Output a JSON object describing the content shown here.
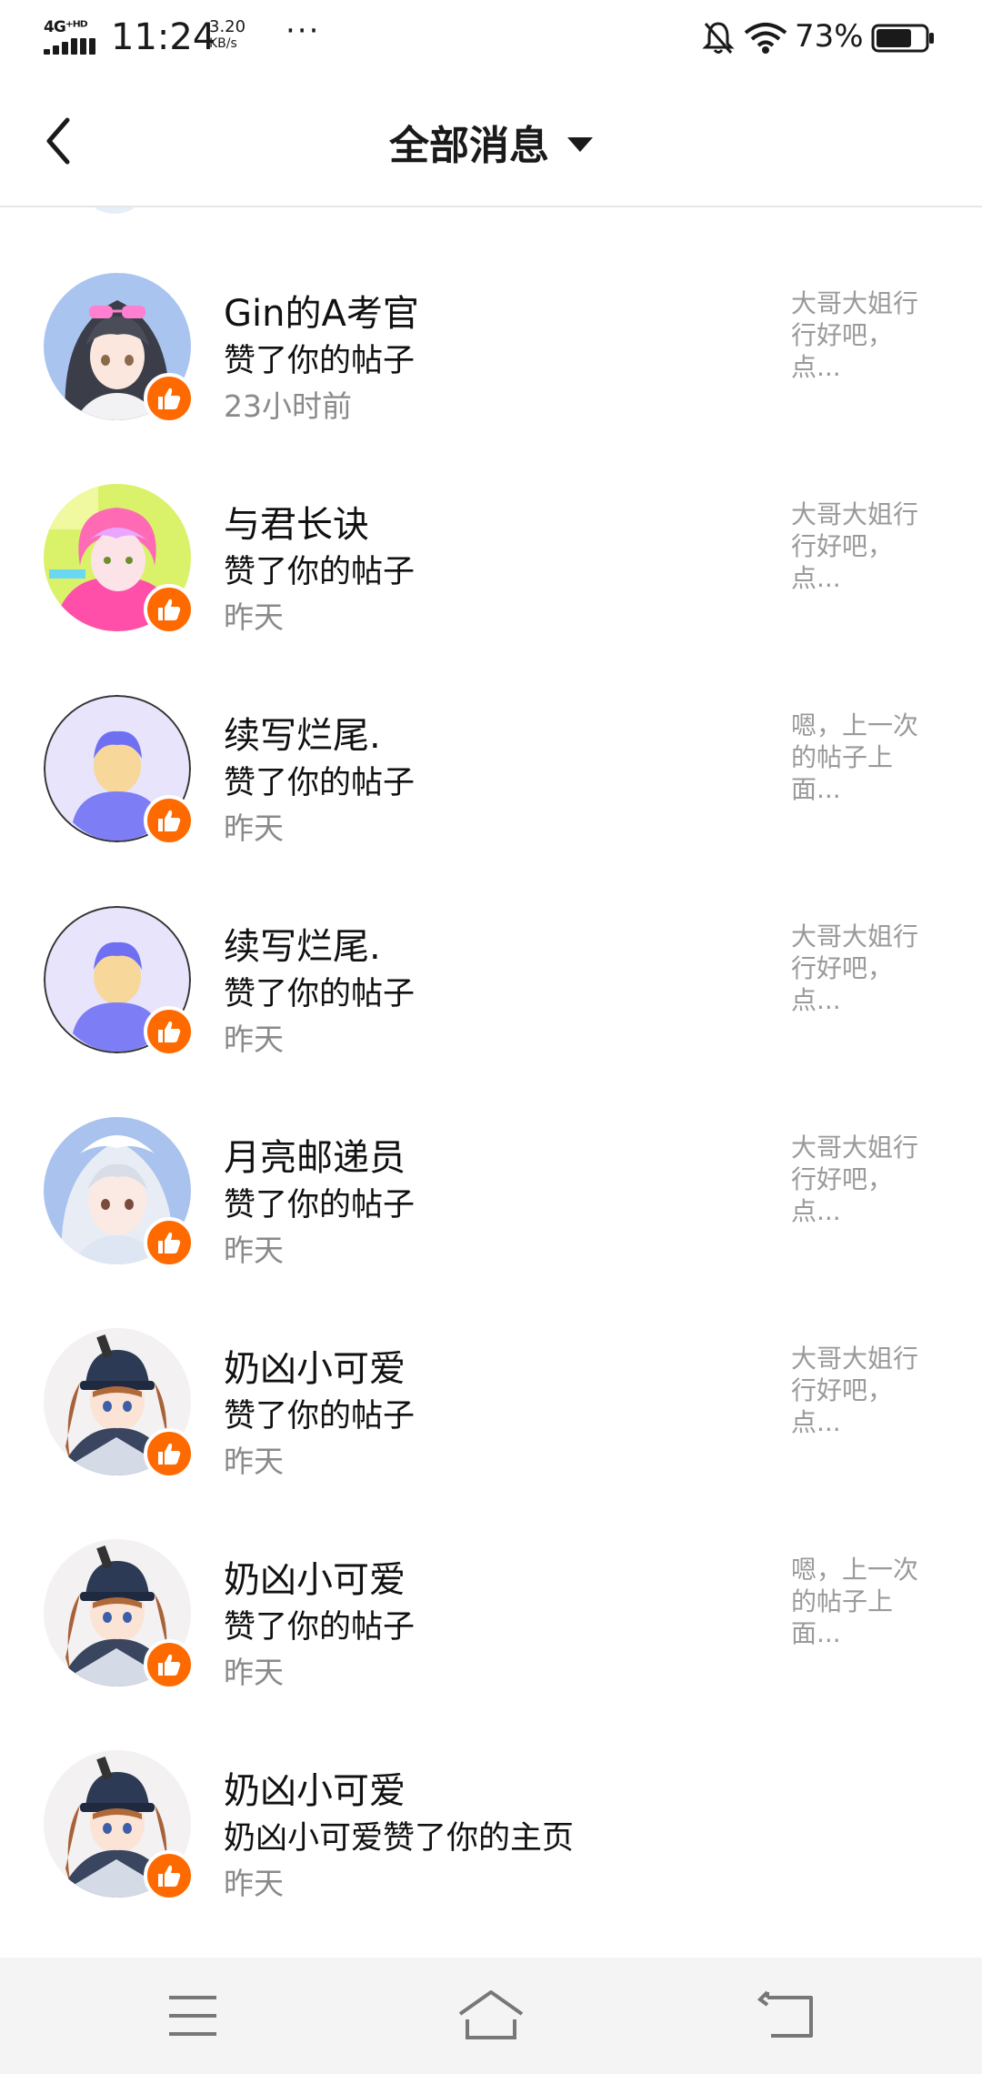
{
  "status_bar": {
    "network": "4G⁺ᴴᴰ",
    "time": "11:24",
    "speed_value": "3.20",
    "speed_unit": "KB/s",
    "more": "···",
    "battery_percent": "73%",
    "battery_level": 0.73
  },
  "header": {
    "title": "全部消息"
  },
  "colors": {
    "accent": "#ff6a00",
    "text_primary": "#111111",
    "text_secondary": "#8a8a8a"
  },
  "messages": [
    {
      "name": "Gin的A考官",
      "action": "赞了你的帖子",
      "time": "23小时前",
      "preview": "大哥大姐行行好吧，点...",
      "avatar": "anime-girl-glasses"
    },
    {
      "name": "与君长诀",
      "action": "赞了你的帖子",
      "time": "昨天",
      "preview": "大哥大姐行行好吧，点...",
      "avatar": "anime-pink-hair"
    },
    {
      "name": "续写烂尾.",
      "action": "赞了你的帖子",
      "time": "昨天",
      "preview": "嗯，上一次的帖子上面...",
      "avatar": "default-avatar"
    },
    {
      "name": "续写烂尾.",
      "action": "赞了你的帖子",
      "time": "昨天",
      "preview": "大哥大姐行行好吧，点...",
      "avatar": "default-avatar"
    },
    {
      "name": "月亮邮递员",
      "action": "赞了你的帖子",
      "time": "昨天",
      "preview": "大哥大姐行行好吧，点...",
      "avatar": "anime-silver-hair"
    },
    {
      "name": "奶凶小可爱",
      "action": "赞了你的帖子",
      "time": "昨天",
      "preview": "大哥大姐行行好吧，点...",
      "avatar": "anime-cap-girl"
    },
    {
      "name": "奶凶小可爱",
      "action": "赞了你的帖子",
      "time": "昨天",
      "preview": "嗯，上一次的帖子上面...",
      "avatar": "anime-cap-girl"
    },
    {
      "name": "奶凶小可爱",
      "action": "奶凶小可爱赞了你的主页",
      "time": "昨天",
      "preview": "",
      "avatar": "anime-cap-girl"
    }
  ]
}
